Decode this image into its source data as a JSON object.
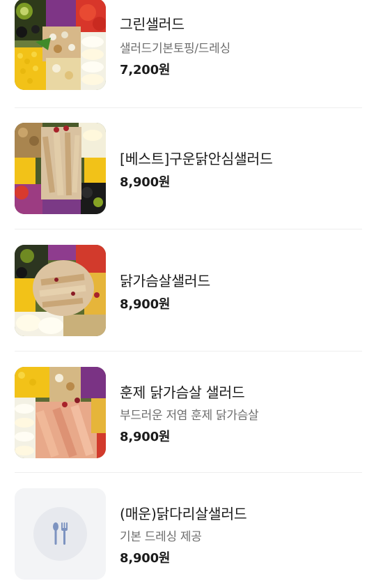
{
  "menu": {
    "items": [
      {
        "name": "그린샐러드",
        "description": "샐러드기본토핑/드레싱",
        "price": "7,200원",
        "image": "salad-photo"
      },
      {
        "name": "[베스트]구운닭안심샐러드",
        "price": "8,900원",
        "image": "grilled-chicken-salad-photo"
      },
      {
        "name": "닭가슴살샐러드",
        "price": "8,900원",
        "image": "chicken-breast-salad-photo"
      },
      {
        "name": "훈제 닭가슴살 샐러드",
        "description": "부드러운 저염 훈제 닭가슴살",
        "price": "8,900원",
        "image": "smoked-chicken-salad-photo"
      },
      {
        "name": "(매운)닭다리살샐러드",
        "description": "기본 드레싱 제공",
        "price": "8,900원",
        "image": "fork-knife-icon"
      }
    ]
  },
  "colors": {
    "text_primary": "#1b1b1b",
    "text_secondary": "#6d6d6d",
    "divider": "#eeeeee",
    "placeholder_bg": "#f3f4f6",
    "placeholder_icon": "#7d93c0"
  }
}
